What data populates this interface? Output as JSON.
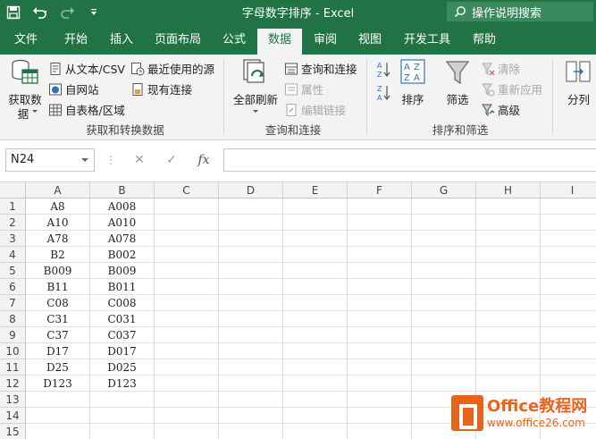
{
  "window": {
    "title": "字母数字排序  -  Excel",
    "tell_me": "操作说明搜索"
  },
  "tabs": [
    "文件",
    "开始",
    "插入",
    "页面布局",
    "公式",
    "数据",
    "审阅",
    "视图",
    "开发工具",
    "帮助"
  ],
  "active_tab": "数据",
  "ribbon": {
    "get_data": "获取数",
    "get_data_2": "据",
    "from_text_csv": "从文本/CSV",
    "from_web": "自网站",
    "from_table": "自表格/区域",
    "recent_sources": "最近使用的源",
    "existing_connections": "现有连接",
    "group1_label": "获取和转换数据",
    "refresh_all": "全部刷新",
    "queries_connections": "查询和连接",
    "properties": "属性",
    "edit_links": "编辑链接",
    "group2_label": "查询和连接",
    "sort": "排序",
    "filter": "筛选",
    "clear": "清除",
    "reapply": "重新应用",
    "advanced": "高级",
    "group3_label": "排序和筛选",
    "text_to_columns": "分列"
  },
  "formula_bar": {
    "name_box": "N24",
    "fx_label": "fx",
    "value": ""
  },
  "grid": {
    "columns": [
      "A",
      "B",
      "C",
      "D",
      "E",
      "F",
      "G",
      "H",
      "I"
    ],
    "rows": [
      "1",
      "2",
      "3",
      "4",
      "5",
      "6",
      "7",
      "8",
      "9",
      "10",
      "11",
      "12",
      "13",
      "14",
      "15"
    ],
    "cells": [
      [
        "A8",
        "A008"
      ],
      [
        "A10",
        "A010"
      ],
      [
        "A78",
        "A078"
      ],
      [
        "B2",
        "B002"
      ],
      [
        "B009",
        "B009"
      ],
      [
        "B11",
        "B011"
      ],
      [
        "C08",
        "C008"
      ],
      [
        "C31",
        "C031"
      ],
      [
        "C37",
        "C037"
      ],
      [
        "D17",
        "D017"
      ],
      [
        "D25",
        "D025"
      ],
      [
        "D123",
        "D123"
      ],
      [
        "",
        ""
      ],
      [
        "",
        ""
      ],
      [
        "",
        ""
      ]
    ]
  },
  "watermark": {
    "brand": "Office教程网",
    "url": "www.office26.com"
  },
  "colors": {
    "brand_green": "#217346",
    "ribbon_bg": "#f3f3f3",
    "watermark_orange": "#e8641b"
  }
}
